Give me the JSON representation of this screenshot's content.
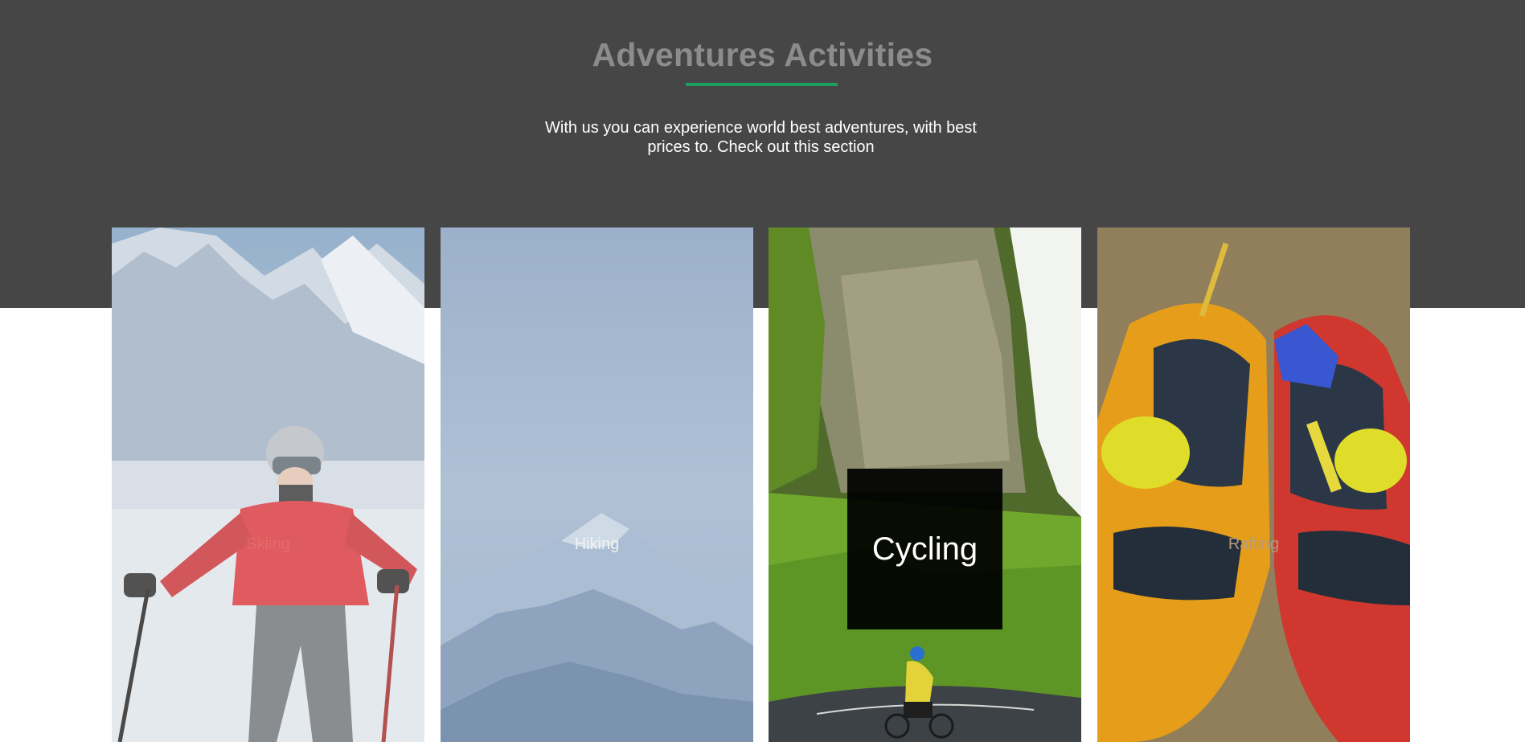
{
  "section": {
    "title": "Adventures Activities",
    "subtitle": "With us you can experience world best adventures, with best prices to. Check out this section"
  },
  "colors": {
    "hero_background": "#464646",
    "title": "#8c8c8c",
    "accent_underline": "#1e9e5e"
  },
  "activities": [
    {
      "label": "Skiing",
      "image": "skier-in-red-jacket-on-snowy-mountain",
      "state": "hover-overlay"
    },
    {
      "label": "Hiking",
      "image": "misty-blue-mountain-peaks",
      "state": "hover-overlay"
    },
    {
      "label": "Cycling",
      "image": "cyclist-on-road-below-green-cliff",
      "state": "active"
    },
    {
      "label": "Rafting",
      "image": "yellow-and-red-kayaks-on-grass",
      "state": "hover-overlay"
    }
  ]
}
